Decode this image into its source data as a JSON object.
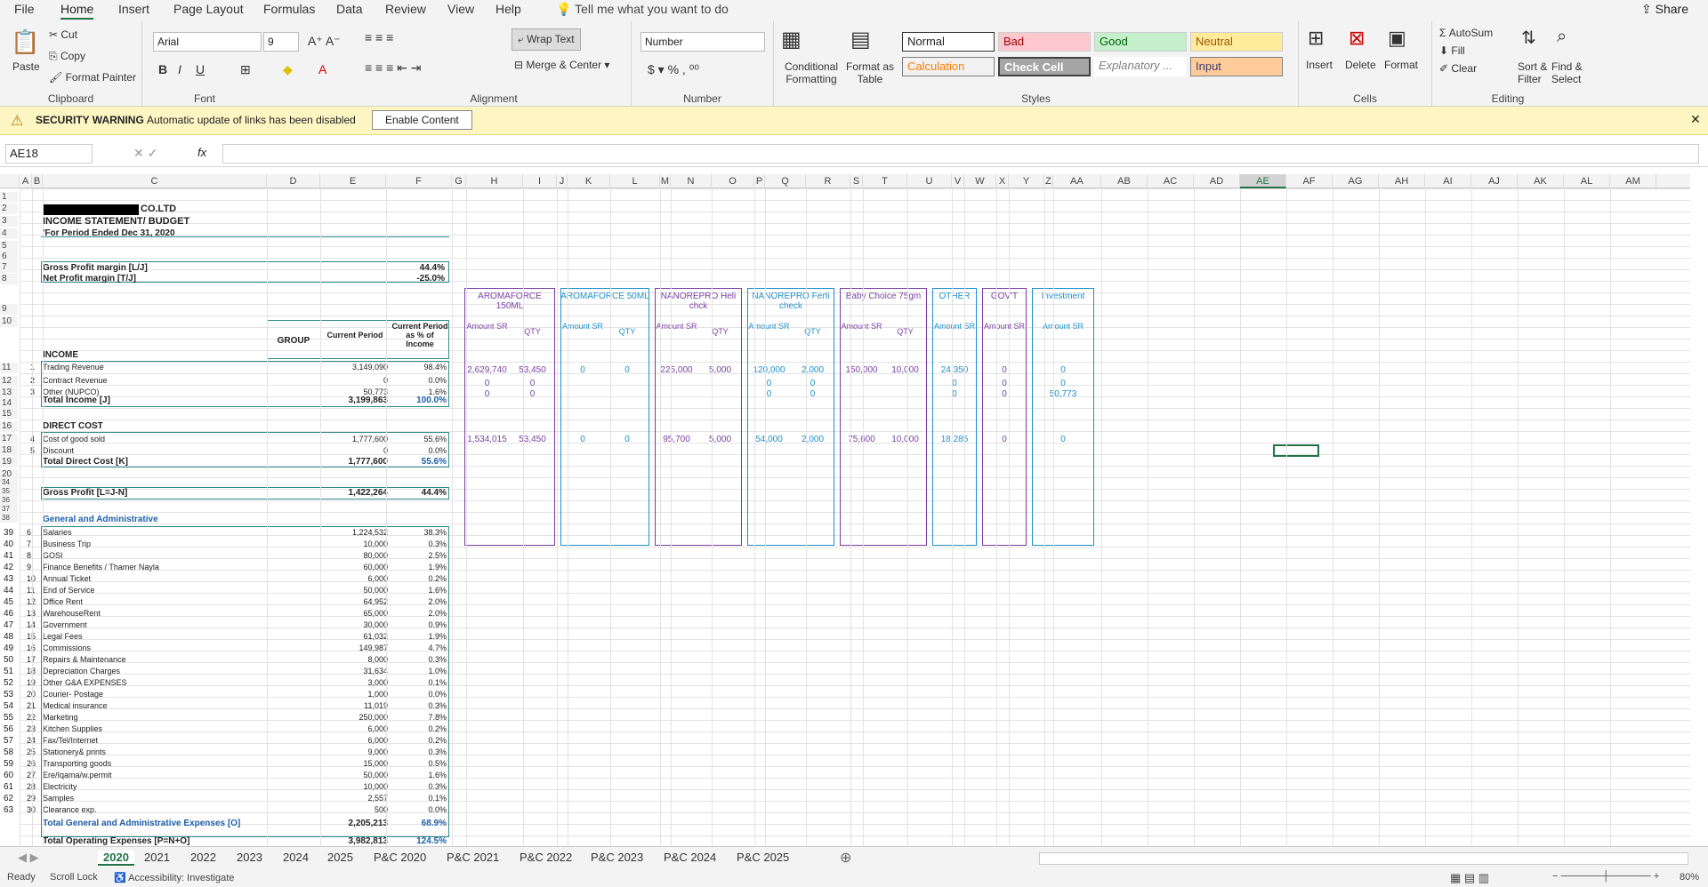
{
  "ribbon_tabs": [
    "File",
    "Home",
    "Insert",
    "Page Layout",
    "Formulas",
    "Data",
    "Review",
    "View",
    "Help"
  ],
  "tell_me": "Tell me what you want to do",
  "share": "Share",
  "clipboard": {
    "paste": "Paste",
    "cut": "Cut",
    "copy": "Copy",
    "format_painter": "Format Painter",
    "label": "Clipboard"
  },
  "font": {
    "name": "Arial",
    "size": "9",
    "label": "Font"
  },
  "alignment": {
    "wrap": "Wrap Text",
    "merge": "Merge & Center",
    "label": "Alignment"
  },
  "number": {
    "format": "Number",
    "label": "Number"
  },
  "styles": {
    "cond": "Conditional Formatting",
    "table": "Format as Table",
    "normal": "Normal",
    "bad": "Bad",
    "good": "Good",
    "neutral": "Neutral",
    "calc": "Calculation",
    "check": "Check Cell",
    "expl": "Explanatory ...",
    "input": "Input",
    "label": "Styles"
  },
  "cells": {
    "insert": "Insert",
    "delete": "Delete",
    "format": "Format",
    "label": "Cells"
  },
  "editing": {
    "autosum": "AutoSum",
    "fill": "Fill",
    "clear": "Clear",
    "sort": "Sort & Filter",
    "find": "Find & Select",
    "label": "Editing"
  },
  "security": {
    "title": "SECURITY WARNING",
    "msg": "Automatic update of links has been disabled",
    "button": "Enable Content"
  },
  "namebox": "AE18",
  "fx": "fx",
  "columns": [
    "A",
    "B",
    "C",
    "D",
    "E",
    "F",
    "G",
    "H",
    "I",
    "J",
    "K",
    "L",
    "M",
    "N",
    "O",
    "P",
    "Q",
    "R",
    "S",
    "T",
    "U",
    "V",
    "W",
    "X",
    "Y",
    "Z",
    "AA",
    "AB",
    "AC",
    "AD",
    "AE",
    "AF",
    "AG",
    "AH",
    "AI",
    "AJ",
    "AK",
    "AL",
    "AM"
  ],
  "company": "CO.LTD",
  "title": "INCOME STATEMENT/ BUDGET",
  "period": "'For Period Ended Dec 31, 2020",
  "gpm_label": "Gross Profit margin  [L/J]",
  "gpm_val": "44.4%",
  "npm_label": "Net Profit margin  [T/J]",
  "npm_val": "-25.0%",
  "hdr_group": "GROUP",
  "hdr_current": "Current Period",
  "hdr_pct": "Current Period as % of Income",
  "income_label": "INCOME",
  "income_rows": [
    {
      "n": "1",
      "label": "Trading Revenue",
      "val": "3,149,090",
      "pct": "98.4%"
    },
    {
      "n": "2",
      "label": "Contract Revenue",
      "val": "0",
      "pct": "0.0%"
    },
    {
      "n": "3",
      "label": "Other (NUPCO)",
      "val": "50,773",
      "pct": "1.6%"
    }
  ],
  "total_income": {
    "label": "Total Income  [J]",
    "val": "3,199,863",
    "pct": "100.0%"
  },
  "direct_label": "DIRECT COST",
  "direct_rows": [
    {
      "n": "4",
      "label": "Cost of good sold",
      "val": "1,777,600",
      "pct": "55.6%"
    },
    {
      "n": "5",
      "label": "Discount",
      "val": "0",
      "pct": "0.0%"
    }
  ],
  "total_direct": {
    "label": "Total Direct Cost  [K]",
    "val": "1,777,600",
    "pct": "55.6%"
  },
  "gross_profit": {
    "label": "Gross Profit  [L=J-N]",
    "val": "1,422,264",
    "pct": "44.4%"
  },
  "ga_label": "General and Administrative",
  "ga_rows": [
    {
      "r": "39",
      "n": "6",
      "label": "Salaries",
      "val": "1,224,532",
      "pct": "38.3%"
    },
    {
      "r": "40",
      "n": "7",
      "label": "Business Trip",
      "val": "10,000",
      "pct": "0.3%"
    },
    {
      "r": "41",
      "n": "8",
      "label": "GOSI",
      "val": "80,000",
      "pct": "2.5%"
    },
    {
      "r": "42",
      "n": "9",
      "label": "Finance Benefits / Thamer Nayla",
      "val": "60,000",
      "pct": "1.9%"
    },
    {
      "r": "43",
      "n": "10",
      "label": "Annual Ticket",
      "val": "6,000",
      "pct": "0.2%"
    },
    {
      "r": "44",
      "n": "11",
      "label": "End of Service",
      "val": "50,000",
      "pct": "1.6%"
    },
    {
      "r": "45",
      "n": "12",
      "label": "Office Rent",
      "val": "64,952",
      "pct": "2.0%"
    },
    {
      "r": "46",
      "n": "13",
      "label": "WarehouseRent",
      "val": "65,000",
      "pct": "2.0%"
    },
    {
      "r": "47",
      "n": "14",
      "label": "Government",
      "val": "30,000",
      "pct": "0.9%"
    },
    {
      "r": "48",
      "n": "15",
      "label": "Legal Fees",
      "val": "61,032",
      "pct": "1.9%"
    },
    {
      "r": "49",
      "n": "16",
      "label": "Commissions",
      "val": "149,987",
      "pct": "4.7%"
    },
    {
      "r": "50",
      "n": "17",
      "label": "Repairs & Maintenance",
      "val": "8,000",
      "pct": "0.3%"
    },
    {
      "r": "51",
      "n": "18",
      "label": "Depreciation Charges",
      "val": "31,634",
      "pct": "1.0%"
    },
    {
      "r": "52",
      "n": "19",
      "label": "Other G&A EXPENSES",
      "val": "3,000",
      "pct": "0.1%"
    },
    {
      "r": "53",
      "n": "20",
      "label": "Courier- Postage",
      "val": "1,000",
      "pct": "0.0%"
    },
    {
      "r": "54",
      "n": "21",
      "label": "Medical insurance",
      "val": "11,019",
      "pct": "0.3%"
    },
    {
      "r": "55",
      "n": "22",
      "label": "Marketing",
      "val": "250,000",
      "pct": "7.8%"
    },
    {
      "r": "56",
      "n": "23",
      "label": "Kitchen Supplies",
      "val": "6,000",
      "pct": "0.2%"
    },
    {
      "r": "57",
      "n": "24",
      "label": "Fax/Tel/Internet",
      "val": "6,000",
      "pct": "0.2%"
    },
    {
      "r": "58",
      "n": "25",
      "label": "Stationery& prints",
      "val": "9,000",
      "pct": "0.3%"
    },
    {
      "r": "59",
      "n": "26",
      "label": "Transporting goods",
      "val": "15,000",
      "pct": "0.5%"
    },
    {
      "r": "60",
      "n": "27",
      "label": "Ere/Iqama/w.permit",
      "val": "50,000",
      "pct": "1.6%"
    },
    {
      "r": "61",
      "n": "28",
      "label": "Electricity",
      "val": "10,000",
      "pct": "0.3%"
    },
    {
      "r": "62",
      "n": "29",
      "label": "Samples",
      "val": "2,557",
      "pct": "0.1%"
    },
    {
      "r": "63",
      "n": "30",
      "label": "Clearance exp.",
      "val": "500",
      "pct": "0.0%"
    }
  ],
  "total_ga": {
    "label": "Total General and Administrative Expenses  [O]",
    "val": "2,205,213",
    "pct": "68.9%"
  },
  "total_op": {
    "label": "Total Operating Expenses  [P=N+O]",
    "val": "3,982,813",
    "pct": "124.5%"
  },
  "products": [
    {
      "name": "AROMAFORCE 150ML",
      "amt": "Amount SR",
      "qty": "QTY",
      "r11a": "2,629,740",
      "r11q": "53,450",
      "r12a": "0",
      "r12q": "0",
      "r13a": "0",
      "r13q": "0",
      "r17a": "1,534,015",
      "r17q": "53,450",
      "color": "#7a3fa0"
    },
    {
      "name": "AROMAFORCE 50ML",
      "amt": "Amount SR",
      "qty": "QTY",
      "r11a": "0",
      "r11q": "0",
      "r12a": "",
      "r12q": "",
      "r13a": "",
      "r13q": "",
      "r17a": "0",
      "r17q": "0",
      "color": "#1e90c8"
    },
    {
      "name": "NANOREPRO  Heli chck",
      "amt": "Amount SR",
      "qty": "QTY",
      "r11a": "225,000",
      "r11q": "5,000",
      "r12a": "",
      "r12q": "",
      "r13a": "",
      "r13q": "",
      "r17a": "95,700",
      "r17q": "5,000",
      "color": "#7a3fa0"
    },
    {
      "name": "NANOREPRO Ferti check",
      "amt": "Amount SR",
      "qty": "QTY",
      "r11a": "120,000",
      "r11q": "2,000",
      "r12a": "0",
      "r12q": "0",
      "r13a": "0",
      "r13q": "0",
      "r17a": "54,000",
      "r17q": "2,000",
      "color": "#1e90c8"
    },
    {
      "name": "Baby Choice 75gm",
      "amt": "Amount SR",
      "qty": "QTY",
      "r11a": "150,000",
      "r11q": "10,000",
      "r12a": "",
      "r12q": "",
      "r13a": "",
      "r13q": "",
      "r17a": "75,600",
      "r17q": "10,000",
      "color": "#7a3fa0"
    },
    {
      "name": "OTHER",
      "amt": "Amount SR",
      "qty": "",
      "r11a": "24,350",
      "r11q": "",
      "r12a": "0",
      "r12q": "",
      "r13a": "0",
      "r13q": "",
      "r17a": "18,285",
      "r17q": "",
      "color": "#1e90c8"
    },
    {
      "name": "GOV'T",
      "amt": "Amount SR",
      "qty": "",
      "r11a": "0",
      "r11q": "",
      "r12a": "0",
      "r12q": "",
      "r13a": "0",
      "r13q": "",
      "r17a": "0",
      "r17q": "",
      "color": "#7a3fa0"
    },
    {
      "name": "Investment",
      "amt": "Amount  SR",
      "qty": "",
      "r11a": "0",
      "r11q": "",
      "r12a": "0",
      "r12q": "",
      "r13a": "50,773",
      "r13q": "",
      "r17a": "0",
      "r17q": "",
      "color": "#1e90c8"
    }
  ],
  "sheet_tabs": [
    "2020",
    "2021",
    "2022",
    "2023",
    "2024",
    "2025",
    "P&C 2020",
    "P&C 2021",
    "P&C 2022",
    "P&C 2023",
    "P&C 2024",
    "P&C 2025"
  ],
  "status": {
    "ready": "Ready",
    "scroll": "Scroll Lock",
    "access": "Accessibility: Investigate",
    "zoom": "80%"
  },
  "colors": {
    "accent": "#217346",
    "teal": "#2f8a8a",
    "warn_bg": "#fdf6c3"
  }
}
